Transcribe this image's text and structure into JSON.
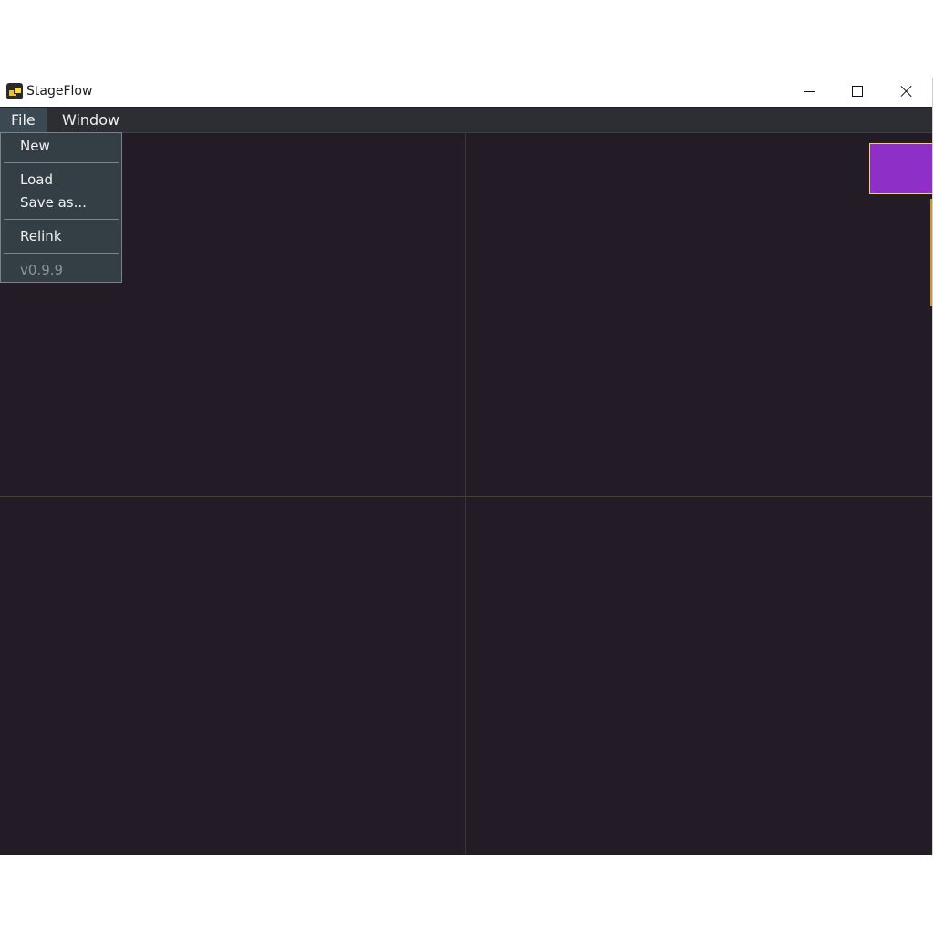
{
  "window": {
    "title": "StageFlow",
    "controls": {
      "minimize": "minimize-icon",
      "maximize": "maximize-icon",
      "close": "close-icon"
    }
  },
  "menubar": {
    "items": [
      {
        "label": "File"
      },
      {
        "label": "Window"
      }
    ]
  },
  "file_menu": {
    "items": [
      {
        "label": "New"
      },
      {
        "label": "Load"
      },
      {
        "label": "Save as..."
      },
      {
        "label": "Relink"
      }
    ],
    "version": "v0.9.9"
  },
  "colors": {
    "canvas_background": "#231c27",
    "node_fill": "#8e30c8",
    "node_border": "#f0d84a",
    "menu_background": "#333e45"
  }
}
